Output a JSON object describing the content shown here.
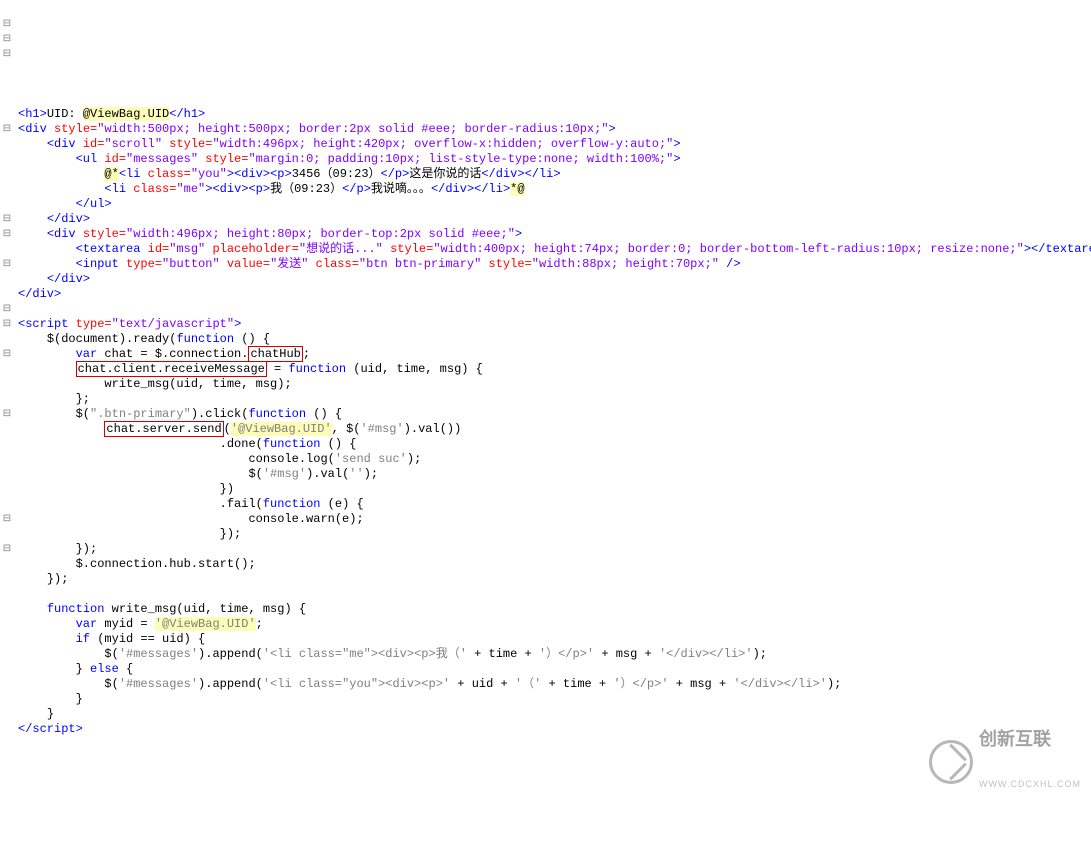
{
  "tokens": {
    "h1_open": "<h1>",
    "h1_close": "</h1>",
    "h1_text": "UID: ",
    "at_viewbag": "@ViewBag.UID",
    "div_open": "<div",
    "div_close": "</div>",
    "close_sc": "/>",
    "gt": ">",
    "style_eq": " style=",
    "div_outer_style": "\"width:500px; height:500px; border:2px solid #eee; border-radius:10px;\"",
    "id_eq": " id=",
    "scroll_id": "\"scroll\"",
    "scroll_style": "\"width:496px; height:420px; overflow-x:hidden; overflow-y:auto;\"",
    "ul_open": "<ul",
    "ul_close": "</ul>",
    "ul_id": "\"messages\"",
    "ul_style": "\"margin:0; padding:10px; list-style-type:none; width:100%;\"",
    "li_open": "<li",
    "li_close": "</li>",
    "class_eq": " class=",
    "you_class": "\"you\"",
    "me_class": "\"me\"",
    "p_open": "<p>",
    "p_close": "</p>",
    "you_p_text": "3456（09:23）",
    "you_div_text": "这是你说的话",
    "me_p_text": "我（09:23）",
    "me_div_text": "我说嘀。。。",
    "comment_open": "@*",
    "comment_close": "*@",
    "div_bottom_style": "\"width:496px; height:80px; border-top:2px solid #eee;\"",
    "textarea_open": "<textarea",
    "textarea_close": "</textarea>",
    "msg_id": "\"msg\"",
    "placeholder_eq": " placeholder=",
    "placeholder_val": "\"想说的话...\"",
    "textarea_style": "\"width:400px; height:74px; border:0; border-bottom-left-radius:10px; resize:none;\"",
    "input_open": "<input",
    "type_eq": " type=",
    "button_val": "\"button\"",
    "value_eq": " value=",
    "send_val": "\"发送\"",
    "btn_class": "\"btn btn-primary\"",
    "btn_style": "\"width:88px; height:70px;\"",
    "script_open": "<script",
    "script_close_tag": "script",
    "script_type": "\"text/javascript\"",
    "doc_ready": "$(document).ready(",
    "func": "function",
    "var_kw": "var",
    "if_kw": "if",
    "else_kw": "else",
    "chat_conn": " chat = $.connection.",
    "chatHub": "chatHub",
    "chat_client": "chat.client.receiveMessage",
    "assign_fn": " = ",
    "fn_sig_uid": " (uid, time, msg) {",
    "write_call": "write_msg(uid, time, msg);",
    "btn_click": "$(",
    "btn_sel": "\".btn-primary\"",
    "click_fn": ").click(",
    "chat_server_send": "chat.server.send",
    "viewbag_str": "'@ViewBag.UID'",
    "msg_sel": "'#msg'",
    "val_call": ").val())",
    "done": ".done(",
    "fail": ".fail(",
    "log_suc": "'send suc'",
    "val_empty": "''",
    "console_log": "console.log(",
    "console_warn": "console.warn(e);",
    "msg_val_set": ").val(",
    "hub_start": "$.connection.hub.start();",
    "write_msg_name": " write_msg(uid, time, msg) {",
    "myid_eq": " myid = ",
    "cond": " (myid == uid) {",
    "messages_sel": "'#messages'",
    "append": ").append(",
    "me_li_str": "'<li class=\"me\"><div><p>我（'",
    "plus_time": " + time + ",
    "close_p_str": "'）</p>'",
    "plus_msg": " + msg + ",
    "close_div_li_str": "'</div></li>'",
    "you_li_str": "'<li class=\"you\"><div><p>'",
    "plus_uid": " + uid + ",
    "open_time_str": "'（'",
    "close_paren_semi": ");",
    "fn_e": " (e) {"
  },
  "gutter": [
    "",
    "⊟",
    "⊟",
    "⊟",
    "",
    "",
    "",
    "",
    "⊟",
    "",
    "",
    "",
    "",
    "",
    "⊟",
    "⊟",
    "",
    "⊟",
    "",
    "",
    "⊟",
    "⊟",
    "",
    "⊟",
    "",
    "",
    "",
    "⊟",
    "",
    "",
    "",
    "",
    "",
    "",
    "⊟",
    "",
    "⊟",
    "",
    "",
    "",
    "",
    "",
    "",
    ""
  ],
  "watermark": {
    "title": "创新互联",
    "sub": "WWW.CDCXHL.COM"
  }
}
